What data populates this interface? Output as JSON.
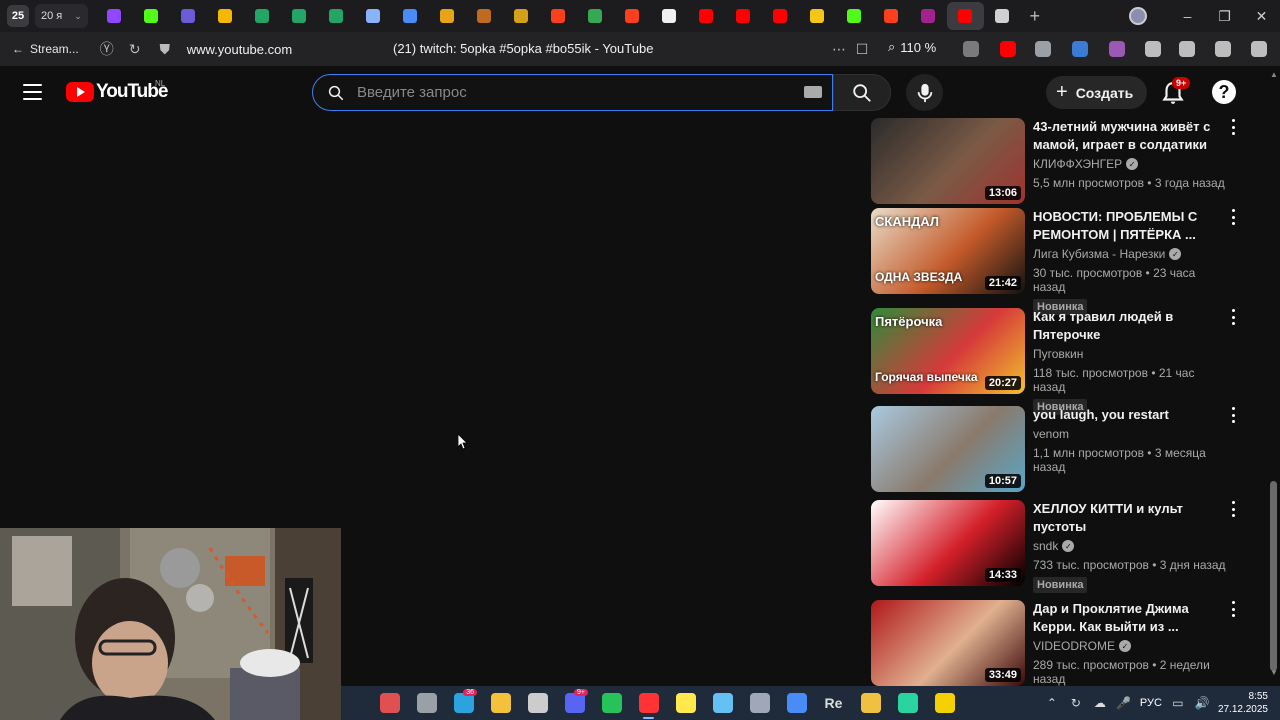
{
  "browser": {
    "tab_counter": "25",
    "tab_group_label": "20 я",
    "tab_favicons": [
      {
        "name": "twitch-tab-icon",
        "color": "#9146ff"
      },
      {
        "name": "kick-tab-icon",
        "color": "#53fc18"
      },
      {
        "name": "eye-tab-icon",
        "color": "#6b5bd6"
      },
      {
        "name": "coin-tab-icon",
        "color": "#f5b700"
      },
      {
        "name": "sheets-tab-icon",
        "color": "#23a566"
      },
      {
        "name": "sheets-tab-icon-2",
        "color": "#23a566"
      },
      {
        "name": "sheets-tab-icon-3",
        "color": "#23a566"
      },
      {
        "name": "chrome-tab-icon",
        "color": "#8ab4f8"
      },
      {
        "name": "colorful-tab-icon",
        "color": "#4a8cf7"
      },
      {
        "name": "trophy-tab-icon",
        "color": "#e8a317"
      },
      {
        "name": "game-tab-icon",
        "color": "#c06a1f"
      },
      {
        "name": "image-tab-icon",
        "color": "#d4a017"
      },
      {
        "name": "yandex-tab-icon",
        "color": "#fc3f1d"
      },
      {
        "name": "green-tab-icon",
        "color": "#34a853"
      },
      {
        "name": "yandex-tab-icon-2",
        "color": "#fc3f1d"
      },
      {
        "name": "github-tab-icon",
        "color": "#f0f0f0"
      },
      {
        "name": "youtube-tab-icon",
        "color": "#ff0000"
      },
      {
        "name": "youtube-tab-icon-2",
        "color": "#ff0000"
      },
      {
        "name": "youtube-tab-icon-3",
        "color": "#ff0000"
      },
      {
        "name": "folder-tab-icon",
        "color": "#f5c518"
      },
      {
        "name": "kick-tab-icon-2",
        "color": "#53fc18"
      },
      {
        "name": "yandex-tab-icon-3",
        "color": "#fc3f1d"
      },
      {
        "name": "wb-tab-icon",
        "color": "#a3228d"
      },
      {
        "name": "youtube-tab-icon-active",
        "color": "#ff0000",
        "active": true
      },
      {
        "name": "page-tab-icon",
        "color": "#d0d0d0"
      }
    ],
    "back_label": "Stream...",
    "url": "www.youtube.com",
    "page_title": "(21) twitch: 5opka #5opka #bo55ik - YouTube",
    "zoom": "110 %",
    "extensions": [
      {
        "name": "abp-extension-icon",
        "color": "#7a7a7a"
      },
      {
        "name": "youtube-extension-icon",
        "color": "#ff0000"
      },
      {
        "name": "printer-extension-icon",
        "color": "#9aa0a6"
      },
      {
        "name": "audio-extension-icon",
        "color": "#3a7bd5"
      },
      {
        "name": "purple-extension-icon",
        "color": "#9b59b6"
      },
      {
        "name": "puzzle-extension-icon",
        "color": "#bdbdbd"
      },
      {
        "name": "video-extension-icon",
        "color": "#bdbdbd"
      },
      {
        "name": "cube-extension-icon",
        "color": "#bdbdbd"
      },
      {
        "name": "download-icon",
        "color": "#bdbdbd"
      }
    ]
  },
  "youtube": {
    "logo_text": "YouTube",
    "region": "NL",
    "search_placeholder": "Введите запрос",
    "create_label": "Создать",
    "notifications_count": "9+",
    "help_label": "?"
  },
  "recommendations": [
    {
      "title": "43-летний мужчина живёт с мамой, играет в солдатики и...",
      "channel": "КЛИФФХЭНГЕР",
      "verified": true,
      "stats": "5,5 млн просмотров • 3 года назад",
      "duration": "13:06",
      "badge": "",
      "thumb_colors": [
        "#2b2b2b",
        "#7a5a46",
        "#a0322d"
      ]
    },
    {
      "title": "НОВОСТИ: ПРОБЛЕМЫ С РЕМОНТОМ | ПЯТЁРКА ...",
      "channel": "Лига Кубизма - Нарезки",
      "verified": true,
      "stats": "30 тыс. просмотров • 23 часа назад",
      "duration": "21:42",
      "badge": "Новинка",
      "thumb_text": [
        "СКАНДАЛ",
        "ОДНА ЗВЕЗДА"
      ],
      "thumb_colors": [
        "#e8dcc8",
        "#c45a2a",
        "#111111"
      ]
    },
    {
      "title": "Как я травил людей в Пятерочке",
      "channel": "Пуговкин",
      "verified": false,
      "stats": "118 тыс. просмотров • 21 час назад",
      "duration": "20:27",
      "badge": "Новинка",
      "thumb_text": [
        "Пятёрочка",
        "Горячая выпечка"
      ],
      "thumb_colors": [
        "#2e8b3a",
        "#d63a3a",
        "#f2c12e"
      ]
    },
    {
      "title": "you laugh, you restart",
      "channel": "venom",
      "verified": false,
      "stats": "1,1 млн просмотров • 3 месяца назад",
      "duration": "10:57",
      "badge": "",
      "thumb_colors": [
        "#a9c9e0",
        "#8a7a6c",
        "#5aa6c7"
      ]
    },
    {
      "title": "ХЕЛЛОУ КИТТИ и культ пустоты",
      "channel": "sndk",
      "verified": true,
      "stats": "733 тыс. просмотров • 3 дня назад",
      "duration": "14:33",
      "badge": "Новинка",
      "thumb_colors": [
        "#ffffff",
        "#d4202a",
        "#000000"
      ]
    },
    {
      "title": "Дар и Проклятие Джима Керри. Как выйти из ...",
      "channel": "VIDEODROME",
      "verified": true,
      "stats": "289 тыс. просмотров • 2 недели назад",
      "duration": "33:49",
      "badge": "",
      "thumb_colors": [
        "#b01818",
        "#e0b090",
        "#3a0808"
      ]
    }
  ],
  "taskbar": {
    "apps": [
      {
        "name": "calendar-app-icon",
        "color": "#e05050"
      },
      {
        "name": "window-app-icon",
        "color": "#9aa0a6"
      },
      {
        "name": "telegram-app-icon",
        "color": "#2aa3df",
        "badge": "36"
      },
      {
        "name": "explorer-app-icon",
        "color": "#f3c13a"
      },
      {
        "name": "obs-app-icon",
        "color": "#cccccc"
      },
      {
        "name": "discord-app-icon",
        "color": "#5865f2",
        "badge": "9+"
      },
      {
        "name": "green-app-icon",
        "color": "#25c35a"
      },
      {
        "name": "yandex-browser-app-icon",
        "color": "#ff3333",
        "active": true
      },
      {
        "name": "notes-app-icon",
        "color": "#ffe94d"
      },
      {
        "name": "steam-app-icon",
        "color": "#66c0f4"
      },
      {
        "name": "settings-app-icon",
        "color": "#a0a8b8"
      },
      {
        "name": "chrome-app-icon",
        "color": "#4a8cf7"
      },
      {
        "name": "reaper-app-icon",
        "color": "#dddddd",
        "text": "Re"
      },
      {
        "name": "star-app-icon",
        "color": "#f0c040"
      },
      {
        "name": "store-app-icon",
        "color": "#2ad4a0"
      },
      {
        "name": "bottle-app-icon",
        "color": "#f5d000"
      }
    ],
    "language": "РУС",
    "time": "8:55",
    "date": "27.12.2025"
  }
}
